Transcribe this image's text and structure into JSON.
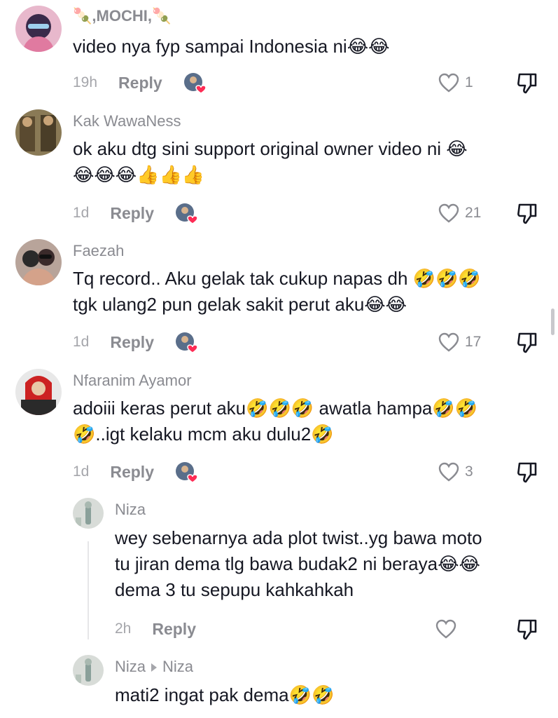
{
  "comments": [
    {
      "username": "🍡,MOCHI,🍡",
      "text": "video nya fyp sampai Indonesia ni😂😂",
      "time": "19h",
      "reply": "Reply",
      "likes": "1",
      "avatar_colors": [
        "#3a2a4a",
        "#e07aa0"
      ]
    },
    {
      "username": "Kak WawaNess",
      "text": "ok aku dtg sini support original owner video ni 😂\n😂😂😂👍👍👍",
      "time": "1d",
      "reply": "Reply",
      "likes": "21",
      "avatar_colors": [
        "#6b5a3a",
        "#a08a5a"
      ]
    },
    {
      "username": "Faezah",
      "text": "Tq record.. Aku gelak tak cukup napas dh 🤣🤣🤣\ntgk ulang2 pun gelak sakit perut aku😂😂",
      "time": "1d",
      "reply": "Reply",
      "likes": "17",
      "avatar_colors": [
        "#2a2a2a",
        "#d4a28a"
      ]
    },
    {
      "username": "Nfaranim Ayamor",
      "text": "adoiii keras perut aku🤣🤣🤣 awatla hampa🤣🤣\n🤣..igt kelaku mcm aku dulu2🤣",
      "time": "1d",
      "reply": "Reply",
      "likes": "3",
      "avatar_colors": [
        "#c0c0c0",
        "#cc2222"
      ]
    }
  ],
  "replies": [
    {
      "username": "Niza",
      "text": "wey sebenarnya ada plot twist..yg bawa moto\ntu jiran dema tlg bawa budak2 ni beraya😂😂\ndema 3 tu sepupu kahkahkah",
      "time": "2h",
      "reply": "Reply"
    },
    {
      "username": "Niza",
      "reply_to": "Niza",
      "text": "mati2 ingat pak dema🤣🤣"
    }
  ],
  "colors": {
    "heart": "#fe2c55",
    "muted": "#8a8b91",
    "text": "#161823"
  }
}
